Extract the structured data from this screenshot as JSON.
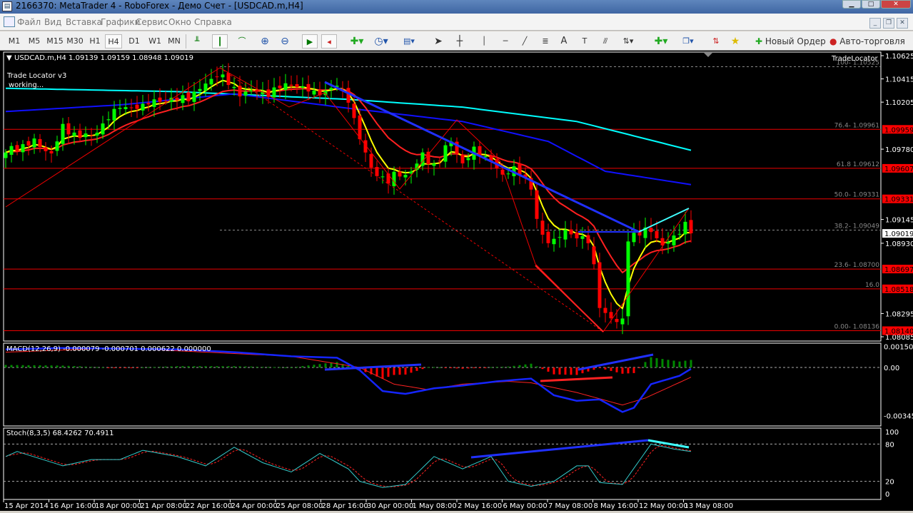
{
  "window": {
    "title": "2166370: MetaTrader 4 - RoboForex - Демо Счет - [USDCAD.m,H4]"
  },
  "menu": [
    "Файл",
    "Вид",
    "Вставка",
    "Графики",
    "Сервис",
    "Окно",
    "Справка"
  ],
  "toolbar": {
    "timeframes": [
      "M1",
      "M5",
      "M15",
      "M30",
      "H1",
      "H4",
      "D1",
      "W1",
      "MN"
    ],
    "selected": "H4",
    "new_order": "Новый Ордер",
    "auto_trading": "Авто-торговля"
  },
  "chart": {
    "header": "USDCAD.m,H4  1.09139 1.09159 1.08948 1.09019",
    "indicator_label": "Trade Locator v3",
    "indicator_status": "working...",
    "corner_label": "TradeLocator",
    "current_price": "1.09019",
    "price_ticks": [
      "1.10625",
      "1.10415",
      "1.10205",
      "1.09780",
      "1.09145",
      "1.08930",
      "1.08295",
      "1.08085"
    ],
    "fib_top": {
      "label": "100- 1.10525",
      "price": 1.10525
    },
    "fib_mid": {
      "label": "38.2- 1.09049",
      "price": 1.09049
    },
    "levels": [
      {
        "label": "76.4- 1.09961",
        "price": 1.09959,
        "tag": "1.09959"
      },
      {
        "label": "61.8 1.09612",
        "price": 1.09607,
        "tag": "1.09607"
      },
      {
        "label": "50.0- 1.09331",
        "price": 1.09331,
        "tag": "1.09331"
      },
      {
        "label": "23.6- 1.08700",
        "price": 1.08697,
        "tag": "1.08697"
      },
      {
        "label": "16.0",
        "price": 1.08518,
        "tag": "1.08518"
      },
      {
        "label": "0.00- 1.08136",
        "price": 1.0814,
        "tag": "1.08140"
      }
    ],
    "colors": {
      "bull": "#00ff00",
      "bear": "#ff0000",
      "fast_ma": "#ffff00",
      "mid_ma": "#ff2020",
      "slow_ma": "#1010ff",
      "long_ma": "#00ffff"
    }
  },
  "chart_data": {
    "type": "candlestick",
    "symbol": "USDCAD.m",
    "timeframe": "H4",
    "bars": 121,
    "close_keypoints": [
      [
        0,
        1.0975
      ],
      [
        4,
        1.0985
      ],
      [
        8,
        1.0975
      ],
      [
        10,
        1.0995
      ],
      [
        15,
        1.099
      ],
      [
        20,
        1.1015
      ],
      [
        25,
        1.102
      ],
      [
        30,
        1.1022
      ],
      [
        35,
        1.1035
      ],
      [
        37,
        1.1048
      ],
      [
        40,
        1.103
      ],
      [
        45,
        1.103
      ],
      [
        50,
        1.1035
      ],
      [
        55,
        1.103
      ],
      [
        58,
        1.1035
      ],
      [
        60,
        1.102
      ],
      [
        62,
        1.099
      ],
      [
        64,
        1.096
      ],
      [
        67,
        1.095
      ],
      [
        70,
        1.0955
      ],
      [
        73,
        1.097
      ],
      [
        75,
        1.0965
      ],
      [
        78,
        1.0985
      ],
      [
        80,
        1.0965
      ],
      [
        82,
        1.0975
      ],
      [
        85,
        1.097
      ],
      [
        87,
        1.0955
      ],
      [
        89,
        1.096
      ],
      [
        91,
        1.095
      ],
      [
        92,
        1.094
      ],
      [
        93,
        1.0915
      ],
      [
        94,
        1.09
      ],
      [
        96,
        1.0897
      ],
      [
        98,
        1.0902
      ],
      [
        100,
        1.09
      ],
      [
        102,
        1.0893
      ],
      [
        103,
        1.087
      ],
      [
        104,
        1.084
      ],
      [
        105,
        1.083
      ],
      [
        107,
        1.082
      ],
      [
        108,
        1.0825
      ],
      [
        109,
        1.09
      ],
      [
        111,
        1.09
      ],
      [
        113,
        1.0905
      ],
      [
        115,
        1.089
      ],
      [
        117,
        1.09
      ],
      [
        119,
        1.0912
      ],
      [
        120,
        1.0902
      ]
    ],
    "slow_ma_keypoints": [
      [
        0,
        1.1012
      ],
      [
        20,
        1.1018
      ],
      [
        40,
        1.1028
      ],
      [
        60,
        1.1015
      ],
      [
        80,
        1.1003
      ],
      [
        95,
        1.0985
      ],
      [
        105,
        1.0958
      ],
      [
        120,
        1.0946
      ]
    ],
    "long_ma_keypoints": [
      [
        0,
        1.1033
      ],
      [
        30,
        1.103
      ],
      [
        60,
        1.1023
      ],
      [
        80,
        1.1016
      ],
      [
        100,
        1.1003
      ],
      [
        120,
        1.0977
      ]
    ],
    "time_labels": [
      "15 Apr 2014",
      "16 Apr 16:00",
      "18 Apr 00:00",
      "21 Apr 08:00",
      "22 Apr 16:00",
      "24 Apr 00:00",
      "25 Apr 08:00",
      "28 Apr 16:00",
      "30 Apr 00:00",
      "1 May 08:00",
      "2 May 16:00",
      "6 May 00:00",
      "7 May 08:00",
      "8 May 16:00",
      "12 May 00:00",
      "13 May 08:00"
    ],
    "macd": {
      "label": "MACD(12,26,9) -0.000079 -0.000701 0.000622 0.000000",
      "ticks": [
        "0.001502",
        "0.00",
        "-0.00345"
      ],
      "main_keypoints": [
        [
          0,
          0.0013
        ],
        [
          10,
          0.0014
        ],
        [
          30,
          0.0013
        ],
        [
          40,
          0.0011
        ],
        [
          50,
          0.0008
        ],
        [
          58,
          0.0007
        ],
        [
          62,
          -0.0002
        ],
        [
          66,
          -0.0017
        ],
        [
          70,
          -0.0019
        ],
        [
          75,
          -0.0015
        ],
        [
          80,
          -0.0013
        ],
        [
          86,
          -0.001
        ],
        [
          92,
          -0.0008
        ],
        [
          96,
          -0.002
        ],
        [
          100,
          -0.0024
        ],
        [
          104,
          -0.0023
        ],
        [
          108,
          -0.0032
        ],
        [
          110,
          -0.0029
        ],
        [
          113,
          -0.0012
        ],
        [
          118,
          -0.0006
        ],
        [
          120,
          -0.0001
        ]
      ],
      "signal_keypoints": [
        [
          0,
          0.0011
        ],
        [
          20,
          0.0014
        ],
        [
          50,
          0.0008
        ],
        [
          62,
          0.0
        ],
        [
          68,
          -0.0012
        ],
        [
          74,
          -0.0016
        ],
        [
          80,
          -0.0012
        ],
        [
          88,
          -0.001
        ],
        [
          92,
          -0.0011
        ],
        [
          100,
          -0.0018
        ],
        [
          108,
          -0.0027
        ],
        [
          112,
          -0.0022
        ],
        [
          120,
          -0.0007
        ]
      ]
    },
    "stoch": {
      "label": "Stoch(8,3,5) 68.4262 70.4911",
      "ticks": [
        "100",
        "80",
        "20",
        "0"
      ],
      "k_keypoints": [
        [
          0,
          60
        ],
        [
          2,
          68
        ],
        [
          10,
          45
        ],
        [
          15,
          55
        ],
        [
          20,
          55
        ],
        [
          24,
          70
        ],
        [
          30,
          60
        ],
        [
          35,
          45
        ],
        [
          40,
          75
        ],
        [
          45,
          50
        ],
        [
          50,
          35
        ],
        [
          55,
          65
        ],
        [
          60,
          40
        ],
        [
          62,
          20
        ],
        [
          66,
          10
        ],
        [
          70,
          15
        ],
        [
          75,
          60
        ],
        [
          80,
          40
        ],
        [
          85,
          60
        ],
        [
          88,
          20
        ],
        [
          92,
          12
        ],
        [
          96,
          20
        ],
        [
          100,
          45
        ],
        [
          102,
          45
        ],
        [
          104,
          18
        ],
        [
          108,
          15
        ],
        [
          113,
          80
        ],
        [
          117,
          72
        ],
        [
          120,
          68
        ]
      ]
    }
  }
}
